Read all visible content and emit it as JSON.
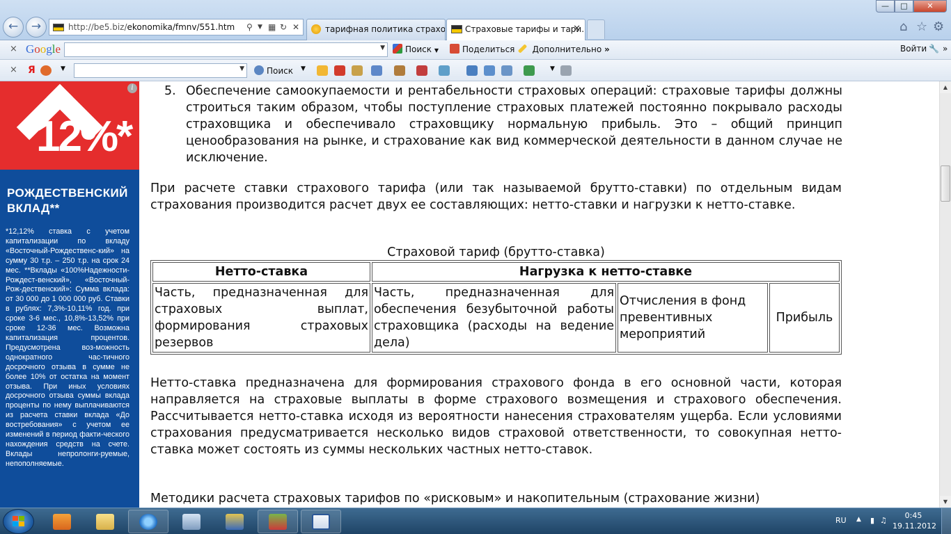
{
  "browser": {
    "url_prefix": "http://be5.biz/",
    "url_rest": "ekonomika/fmnv/551.htm",
    "tabs": [
      {
        "label": "тарифная политика страхов..."
      },
      {
        "label": "Страховые тарифы и тари..."
      }
    ]
  },
  "google_toolbar": {
    "logo": "Google",
    "search_label": "Поиск",
    "share_label": "Поделиться",
    "more_label": "Дополнительно",
    "signin_label": "Войти"
  },
  "yandex_toolbar": {
    "logo": "Я",
    "search_label": "Поиск"
  },
  "ad": {
    "percent": "12%*",
    "title": "РОЖДЕСТВЕНСКИЙ ВКЛАД**",
    "text": "*12,12% ставка с учетом капитализации по вкладу «Восточный-Рождественс-кий» на сумму 30 т.р. – 250 т.р. на срок 24 мес. **Вклады «100%Надежности-Рождест-венский», «Восточный-Рож-дественский»: Сумма вклада: от 30 000 до 1 000 000 руб. Ставки в рублях: 7,3%-10,11% год. при сроке 3-6 мес., 10,8%-13,52% при сроке 12-36 мес. Возможна капитализация процентов. Предусмотрена воз-можность однократного час-тичного досрочного отзыва в сумме не более 10% от остатка на момент отзыва. При иных условиях досрочного отзыва суммы вклада проценты по нему выплачиваются из расчета ставки вклада «До востребования» с учетом ее изменений в период факти-ческого нахождения средств на счете. Вклады непролонги-руемые, непополняемые."
  },
  "content": {
    "list_item_number": "5.",
    "list_item_text": "Обеспечение самоокупаемости и рентабельности страховых операций: страховые тарифы должны строиться таким образом, чтобы поступление страховых платежей постоянно покрывало расходы страховщика и обеспечивало страховщику нормальную прибыль. Это – общий принцип ценообразования на рынке, и страхование как вид коммерческой деятельности в данном случае не исключение.",
    "paragraph1": "При расчете ставки страхового тарифа (или так называемой брутто-ставки) по отдельным видам страхования производится расчет двух ее составляющих: нетто-ставки и нагрузки к нетто-ставке.",
    "table_caption": "Страховой тариф (брутто-ставка)",
    "table": {
      "header_net": "Нетто-ставка",
      "header_load": "Нагрузка к нетто-ставке",
      "cell_net": "Часть, предназначенная для страховых выплат, формирования страховых резервов",
      "cell_business": "Часть, предназначенная для обеспечения безубыточной работы страховщика (расходы на ведение дела)",
      "cell_preventive": "Отчисления в фонд превентивных мероприятий",
      "cell_profit": "Прибыль"
    },
    "paragraph2": "Нетто-ставка предназначена для формирования страхового фонда в его основной части, которая направляется на страховые выплаты в форме страхового возмещения и страхового обеспечения. Рассчитывается нетто-ставка исходя из вероятности нанесения страхователям ущерба. Если условиями страхования предусматривается несколько видов страховой ответственности, то совокупная нетто-ставка может состоять из суммы нескольких частных нетто-ставок.",
    "paragraph3": "Методики расчета страховых тарифов по «рисковым» и накопительным (страхование жизни)"
  },
  "taskbar": {
    "language": "RU",
    "time": "0:45",
    "date": "19.11.2012"
  }
}
